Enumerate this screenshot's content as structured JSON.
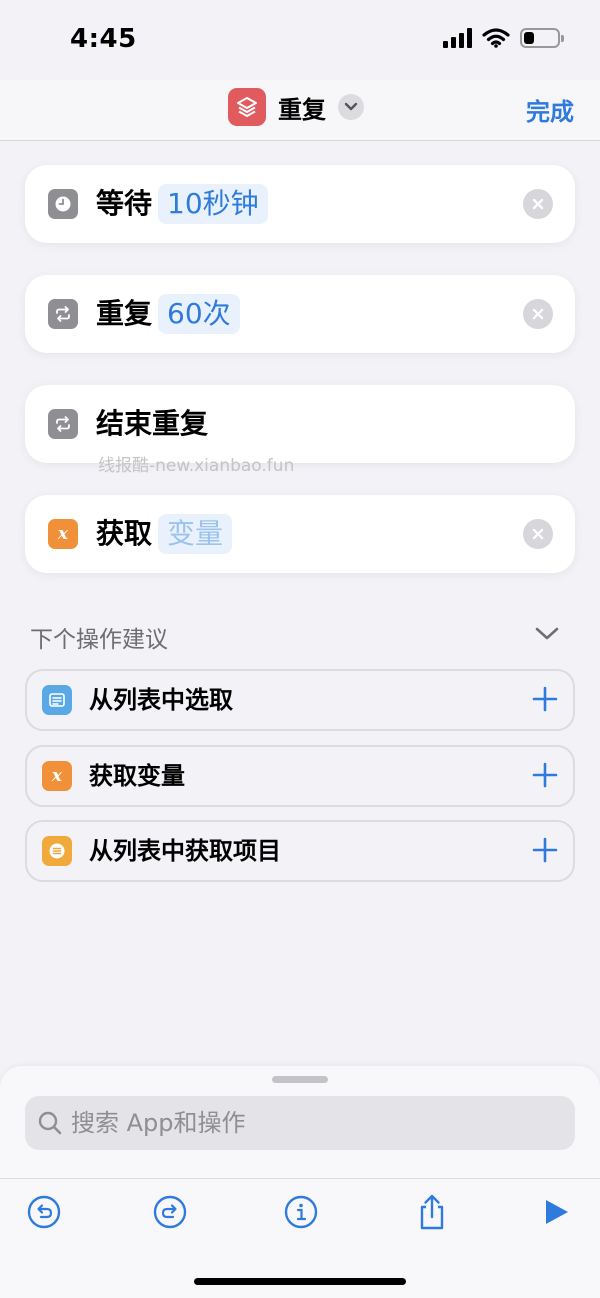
{
  "status_bar": {
    "time": "4:45",
    "battery_level": 0.3
  },
  "nav": {
    "title": "重复",
    "done_label": "完成",
    "icon": "layers-icon",
    "accent_color": "#2f7bdc",
    "app_icon_color": "#e05a5e"
  },
  "actions": [
    {
      "label": "等待",
      "token": "10秒钟",
      "icon": "clock-icon",
      "removable": true
    },
    {
      "label": "重复",
      "token": "60次",
      "icon": "repeat-icon",
      "removable": true
    },
    {
      "label": "结束重复",
      "token": "",
      "icon": "repeat-icon",
      "removable": false
    },
    {
      "label": "获取",
      "token": "变量",
      "token_placeholder": true,
      "icon": "variable-icon",
      "removable": true
    }
  ],
  "watermark": "线报酷-new.xianbao.fun",
  "suggestions": {
    "title": "下个操作建议",
    "items": [
      {
        "label": "从列表中选取",
        "icon": "list-select-icon"
      },
      {
        "label": "获取变量",
        "icon": "variable-icon"
      },
      {
        "label": "从列表中获取项目",
        "icon": "list-item-icon"
      }
    ]
  },
  "search": {
    "placeholder": "搜索 App和操作"
  },
  "toolbar": [
    "undo-icon",
    "redo-icon",
    "info-icon",
    "share-icon",
    "play-icon"
  ]
}
